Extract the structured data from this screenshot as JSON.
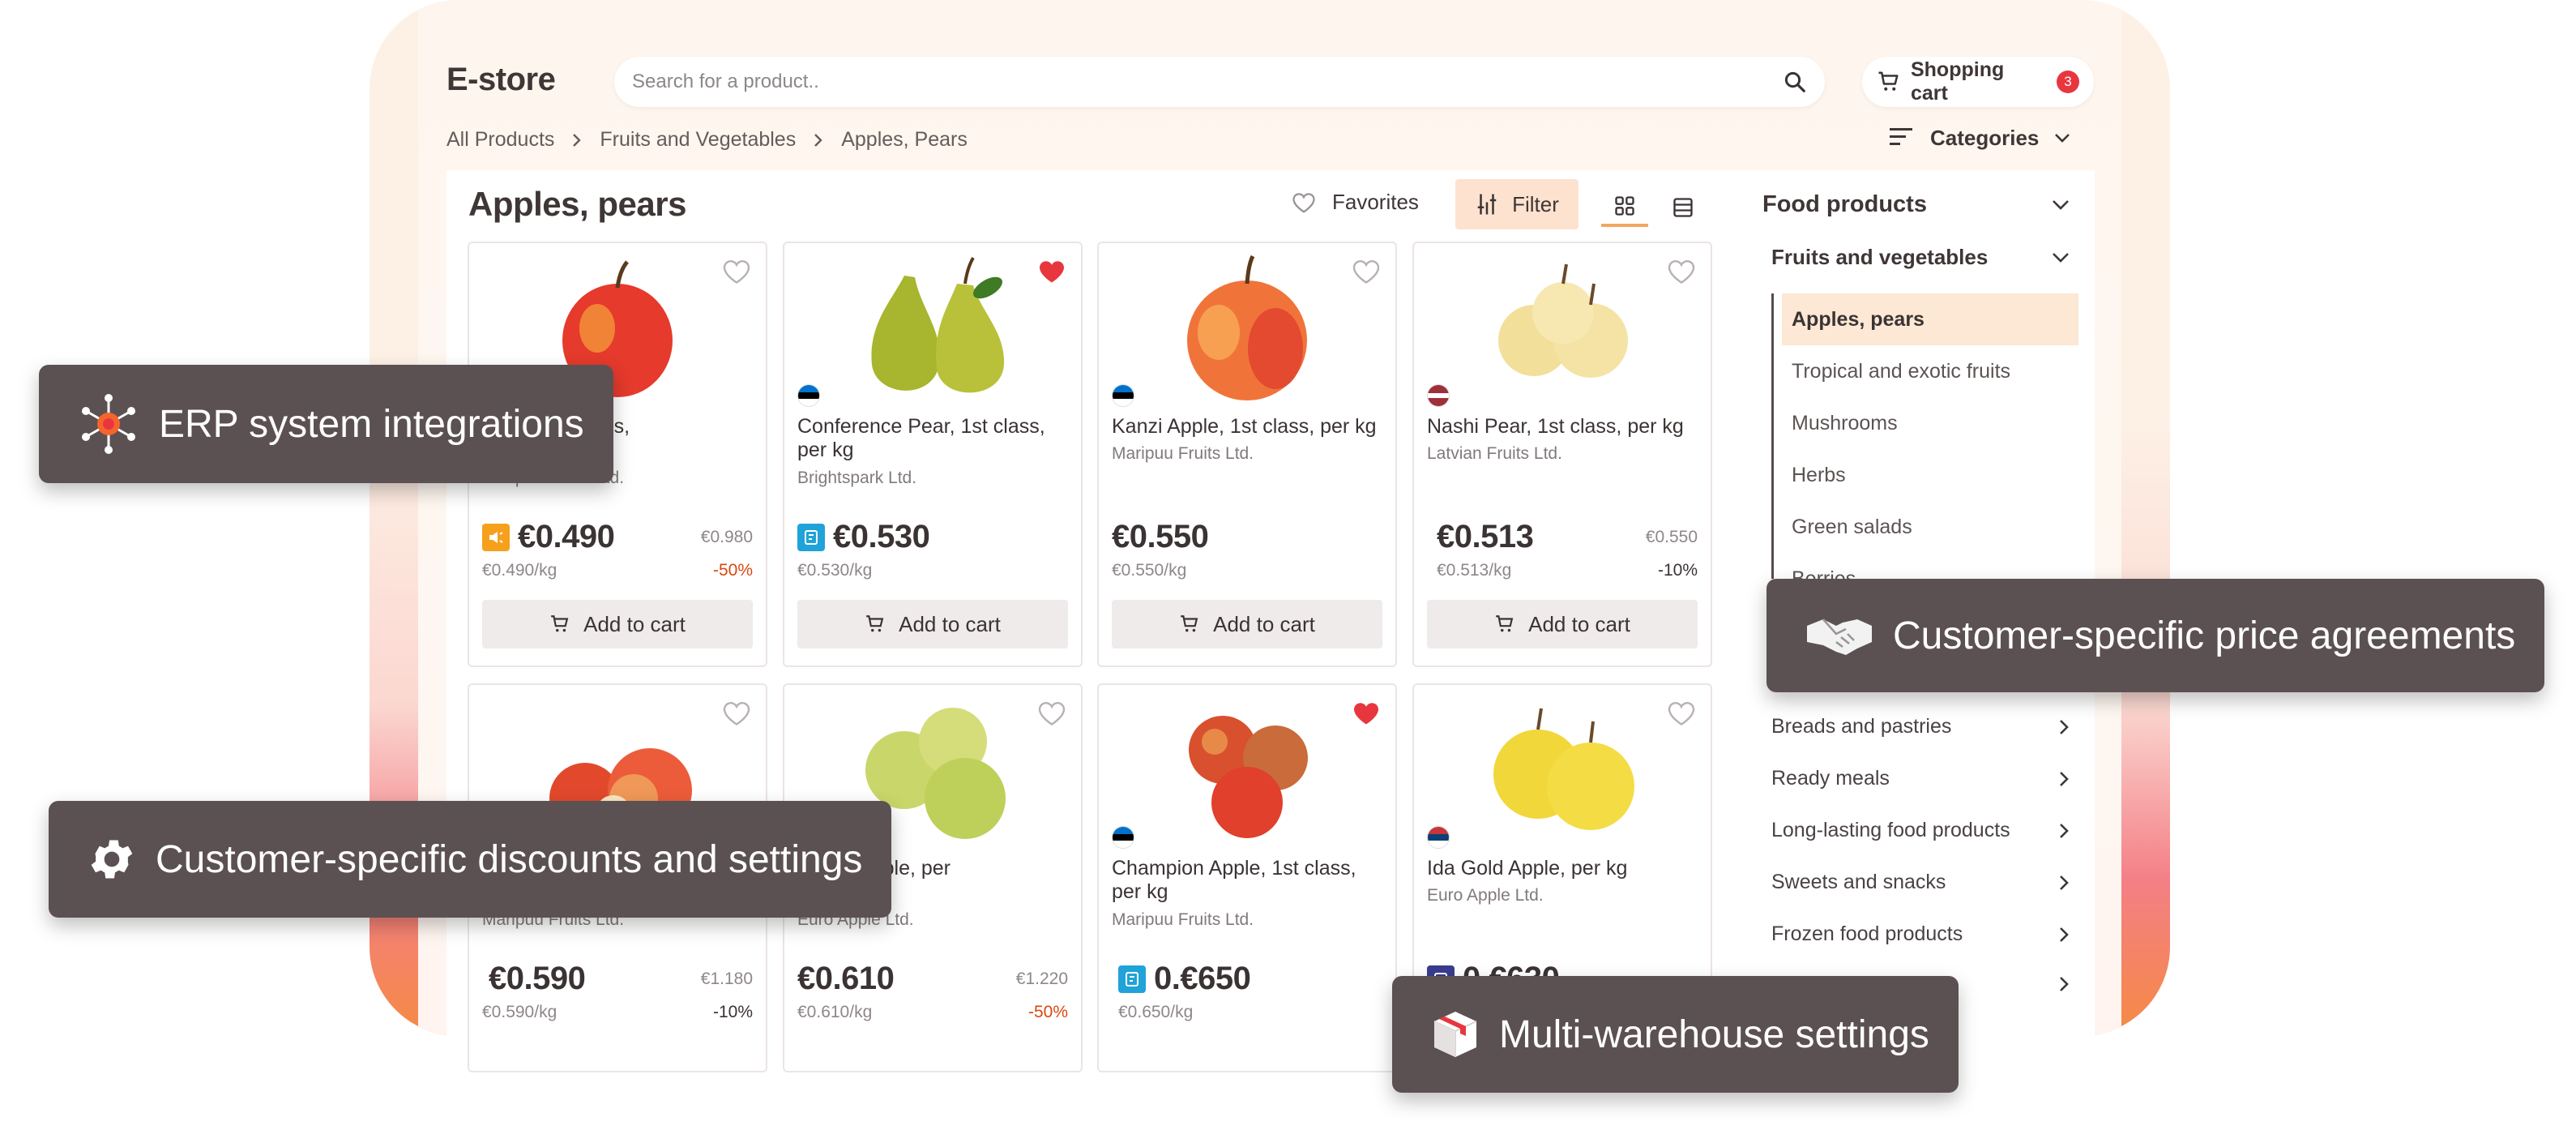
{
  "app": {
    "brand": "E-store"
  },
  "header": {
    "search_placeholder": "Search for a product..",
    "cart_label": "Shopping cart",
    "cart_count": "3"
  },
  "breadcrumb": [
    "All Products",
    "Fruits and Vegetables",
    "Apples, Pears"
  ],
  "categories_label": "Categories",
  "page": {
    "title": "Apples, pears",
    "favorites_label": "Favorites",
    "filter_label": "Filter"
  },
  "add_to_cart_label": "Add to cart",
  "products": [
    {
      "name": "Apple, 1st class,",
      "supplier": "Maripuu Fruits Ltd.",
      "price": "€0.490",
      "old_price": "€0.980",
      "unit": "€0.490/kg",
      "discount": "-50%",
      "favorite": false
    },
    {
      "name": "Conference Pear, 1st class, per kg",
      "supplier": "Brightspark Ltd.",
      "price": "€0.530",
      "old_price": "",
      "unit": "€0.530/kg",
      "discount": "",
      "favorite": true
    },
    {
      "name": "Kanzi Apple, 1st class, per kg",
      "supplier": "Maripuu Fruits Ltd.",
      "price": "€0.550",
      "old_price": "",
      "unit": "€0.550/kg",
      "discount": "",
      "favorite": false
    },
    {
      "name": "Nashi Pear, 1st class, per kg",
      "supplier": "Latvian Fruits Ltd.",
      "price": "€0.513",
      "old_price": "€0.550",
      "unit": "€0.513/kg",
      "discount": "-10%",
      "favorite": false
    },
    {
      "name": "",
      "supplier": "Maripuu Fruits Ltd.",
      "price": "€0.590",
      "old_price": "€1.180",
      "unit": "€0.590/kg",
      "discount": "-10%",
      "favorite": false
    },
    {
      "name": "licious Apple, per",
      "supplier": "Euro Apple Ltd.",
      "price": "€0.610",
      "old_price": "€1.220",
      "unit": "€0.610/kg",
      "discount": "-50%",
      "favorite": false
    },
    {
      "name": "Champion Apple, 1st class, per kg",
      "supplier": "Maripuu Fruits Ltd.",
      "price": "0.€650",
      "old_price": "",
      "unit": "€0.650/kg",
      "discount": "",
      "favorite": true
    },
    {
      "name": "Ida Gold Apple, per kg",
      "supplier": "Euro Apple Ltd.",
      "price": "0.€630",
      "old_price": "",
      "unit": "",
      "discount": "",
      "favorite": false
    }
  ],
  "sidebar": {
    "head": "Food products",
    "sub": "Fruits and vegetables",
    "sub_items": [
      "Apples, pears",
      "Tropical and exotic fruits",
      "Mushrooms",
      "Herbs",
      "Green salads",
      "Berries"
    ],
    "categories": [
      "Breads and pastries",
      "Ready meals",
      "Long-lasting food products",
      "Sweets and snacks",
      "Frozen food products"
    ]
  },
  "feature_tags": {
    "erp": "ERP system integrations",
    "price_agreements": "Customer-specific price agreements",
    "discounts": "Customer-specific discounts and settings",
    "warehouse": "Multi-warehouse settings"
  },
  "colors": {
    "accent": "#f2a660",
    "favorite": "#e8363f",
    "discount_red": "#d9480f",
    "tag_bg": "#5c5152"
  }
}
